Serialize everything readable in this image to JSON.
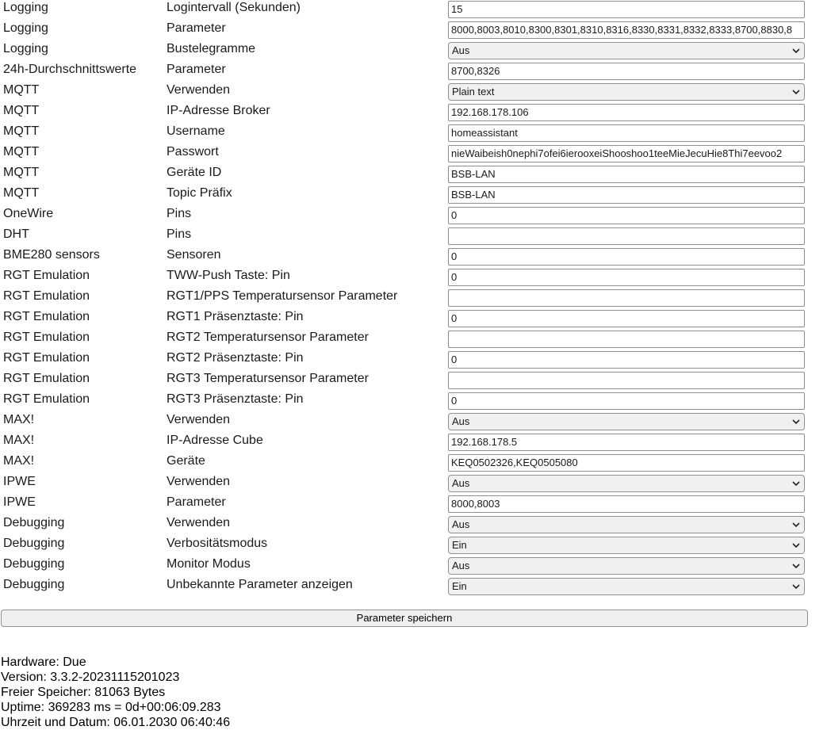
{
  "settings": [
    {
      "category": "Logging",
      "label": "Logintervall (Sekunden)",
      "type": "input",
      "value": "15"
    },
    {
      "category": "Logging",
      "label": "Parameter",
      "type": "input",
      "value": "8000,8003,8010,8300,8301,8310,8316,8330,8331,8332,8333,8700,8830,8"
    },
    {
      "category": "Logging",
      "label": "Bustelegramme",
      "type": "select",
      "value": "Aus"
    },
    {
      "category": "24h-Durchschnittswerte",
      "label": "Parameter",
      "type": "input",
      "value": "8700,8326"
    },
    {
      "category": "MQTT",
      "label": "Verwenden",
      "type": "select",
      "value": "Plain text"
    },
    {
      "category": "MQTT",
      "label": "IP-Adresse Broker",
      "type": "input",
      "value": "192.168.178.106"
    },
    {
      "category": "MQTT",
      "label": "Username",
      "type": "input",
      "value": "homeassistant"
    },
    {
      "category": "MQTT",
      "label": "Passwort",
      "type": "input",
      "value": "nieWaibeish0nephi7ofei6ierooxeiShooshoo1teeMieJecuHie8Thi7eevoo2"
    },
    {
      "category": "MQTT",
      "label": "Geräte ID",
      "type": "input",
      "value": "BSB-LAN"
    },
    {
      "category": "MQTT",
      "label": "Topic Präfix",
      "type": "input",
      "value": "BSB-LAN"
    },
    {
      "category": "OneWire",
      "label": "Pins",
      "type": "input",
      "value": "0"
    },
    {
      "category": "DHT",
      "label": "Pins",
      "type": "input",
      "value": ""
    },
    {
      "category": "BME280 sensors",
      "label": "Sensoren",
      "type": "input",
      "value": "0"
    },
    {
      "category": "RGT Emulation",
      "label": "TWW-Push Taste: Pin",
      "type": "input",
      "value": "0"
    },
    {
      "category": "RGT Emulation",
      "label": "RGT1/PPS Temperatursensor Parameter",
      "type": "input",
      "value": ""
    },
    {
      "category": "RGT Emulation",
      "label": "RGT1 Präsenztaste: Pin",
      "type": "input",
      "value": "0"
    },
    {
      "category": "RGT Emulation",
      "label": "RGT2 Temperatursensor Parameter",
      "type": "input",
      "value": ""
    },
    {
      "category": "RGT Emulation",
      "label": "RGT2 Präsenztaste: Pin",
      "type": "input",
      "value": "0"
    },
    {
      "category": "RGT Emulation",
      "label": "RGT3 Temperatursensor Parameter",
      "type": "input",
      "value": ""
    },
    {
      "category": "RGT Emulation",
      "label": "RGT3 Präsenztaste: Pin",
      "type": "input",
      "value": "0"
    },
    {
      "category": "MAX!",
      "label": "Verwenden",
      "type": "select",
      "value": "Aus"
    },
    {
      "category": "MAX!",
      "label": "IP-Adresse Cube",
      "type": "input",
      "value": "192.168.178.5"
    },
    {
      "category": "MAX!",
      "label": "Geräte",
      "type": "input",
      "value": "KEQ0502326,KEQ0505080"
    },
    {
      "category": "IPWE",
      "label": "Verwenden",
      "type": "select",
      "value": "Aus"
    },
    {
      "category": "IPWE",
      "label": "Parameter",
      "type": "input",
      "value": "8000,8003"
    },
    {
      "category": "Debugging",
      "label": "Verwenden",
      "type": "select",
      "value": "Aus"
    },
    {
      "category": "Debugging",
      "label": "Verbositätsmodus",
      "type": "select",
      "value": "Ein"
    },
    {
      "category": "Debugging",
      "label": "Monitor Modus",
      "type": "select",
      "value": "Aus"
    },
    {
      "category": "Debugging",
      "label": "Unbekannte Parameter anzeigen",
      "type": "select",
      "value": "Ein"
    }
  ],
  "save_button_label": "Parameter speichern",
  "info": {
    "hardware": "Hardware: Due",
    "version": "Version: 3.3.2-20231115201023",
    "memory": "Freier Speicher: 81063 Bytes",
    "uptime": "Uptime: 369283 ms = 0d+00:06:09.283",
    "datetime": "Uhrzeit und Datum: 06.01.2030 06:40:46"
  }
}
